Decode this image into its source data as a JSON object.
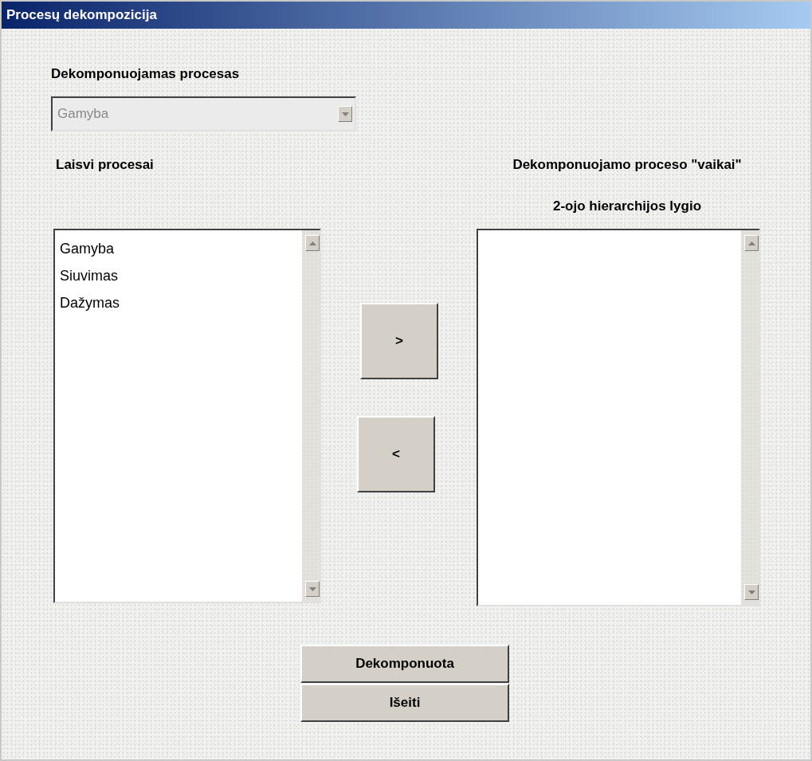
{
  "window": {
    "title": "Procesų dekompozicija"
  },
  "process_field": {
    "label": "Dekomponuojamas procesas",
    "value": "Gamyba",
    "disabled": true
  },
  "free_list": {
    "label": "Laisvi procesai",
    "items": [
      {
        "text": "Gamyba",
        "selected": false
      },
      {
        "text": "Siuvimas",
        "selected": false
      },
      {
        "text": "Dažymas",
        "selected": false
      }
    ]
  },
  "children_list": {
    "label": "Dekomponuojamo proceso \"vaikai\"",
    "sublabel": "2-ojo  hierarchijos lygio"
  },
  "move_buttons": [
    ">",
    "<"
  ],
  "buttons": [
    "Dekomponuota",
    "Išeiti"
  ]
}
